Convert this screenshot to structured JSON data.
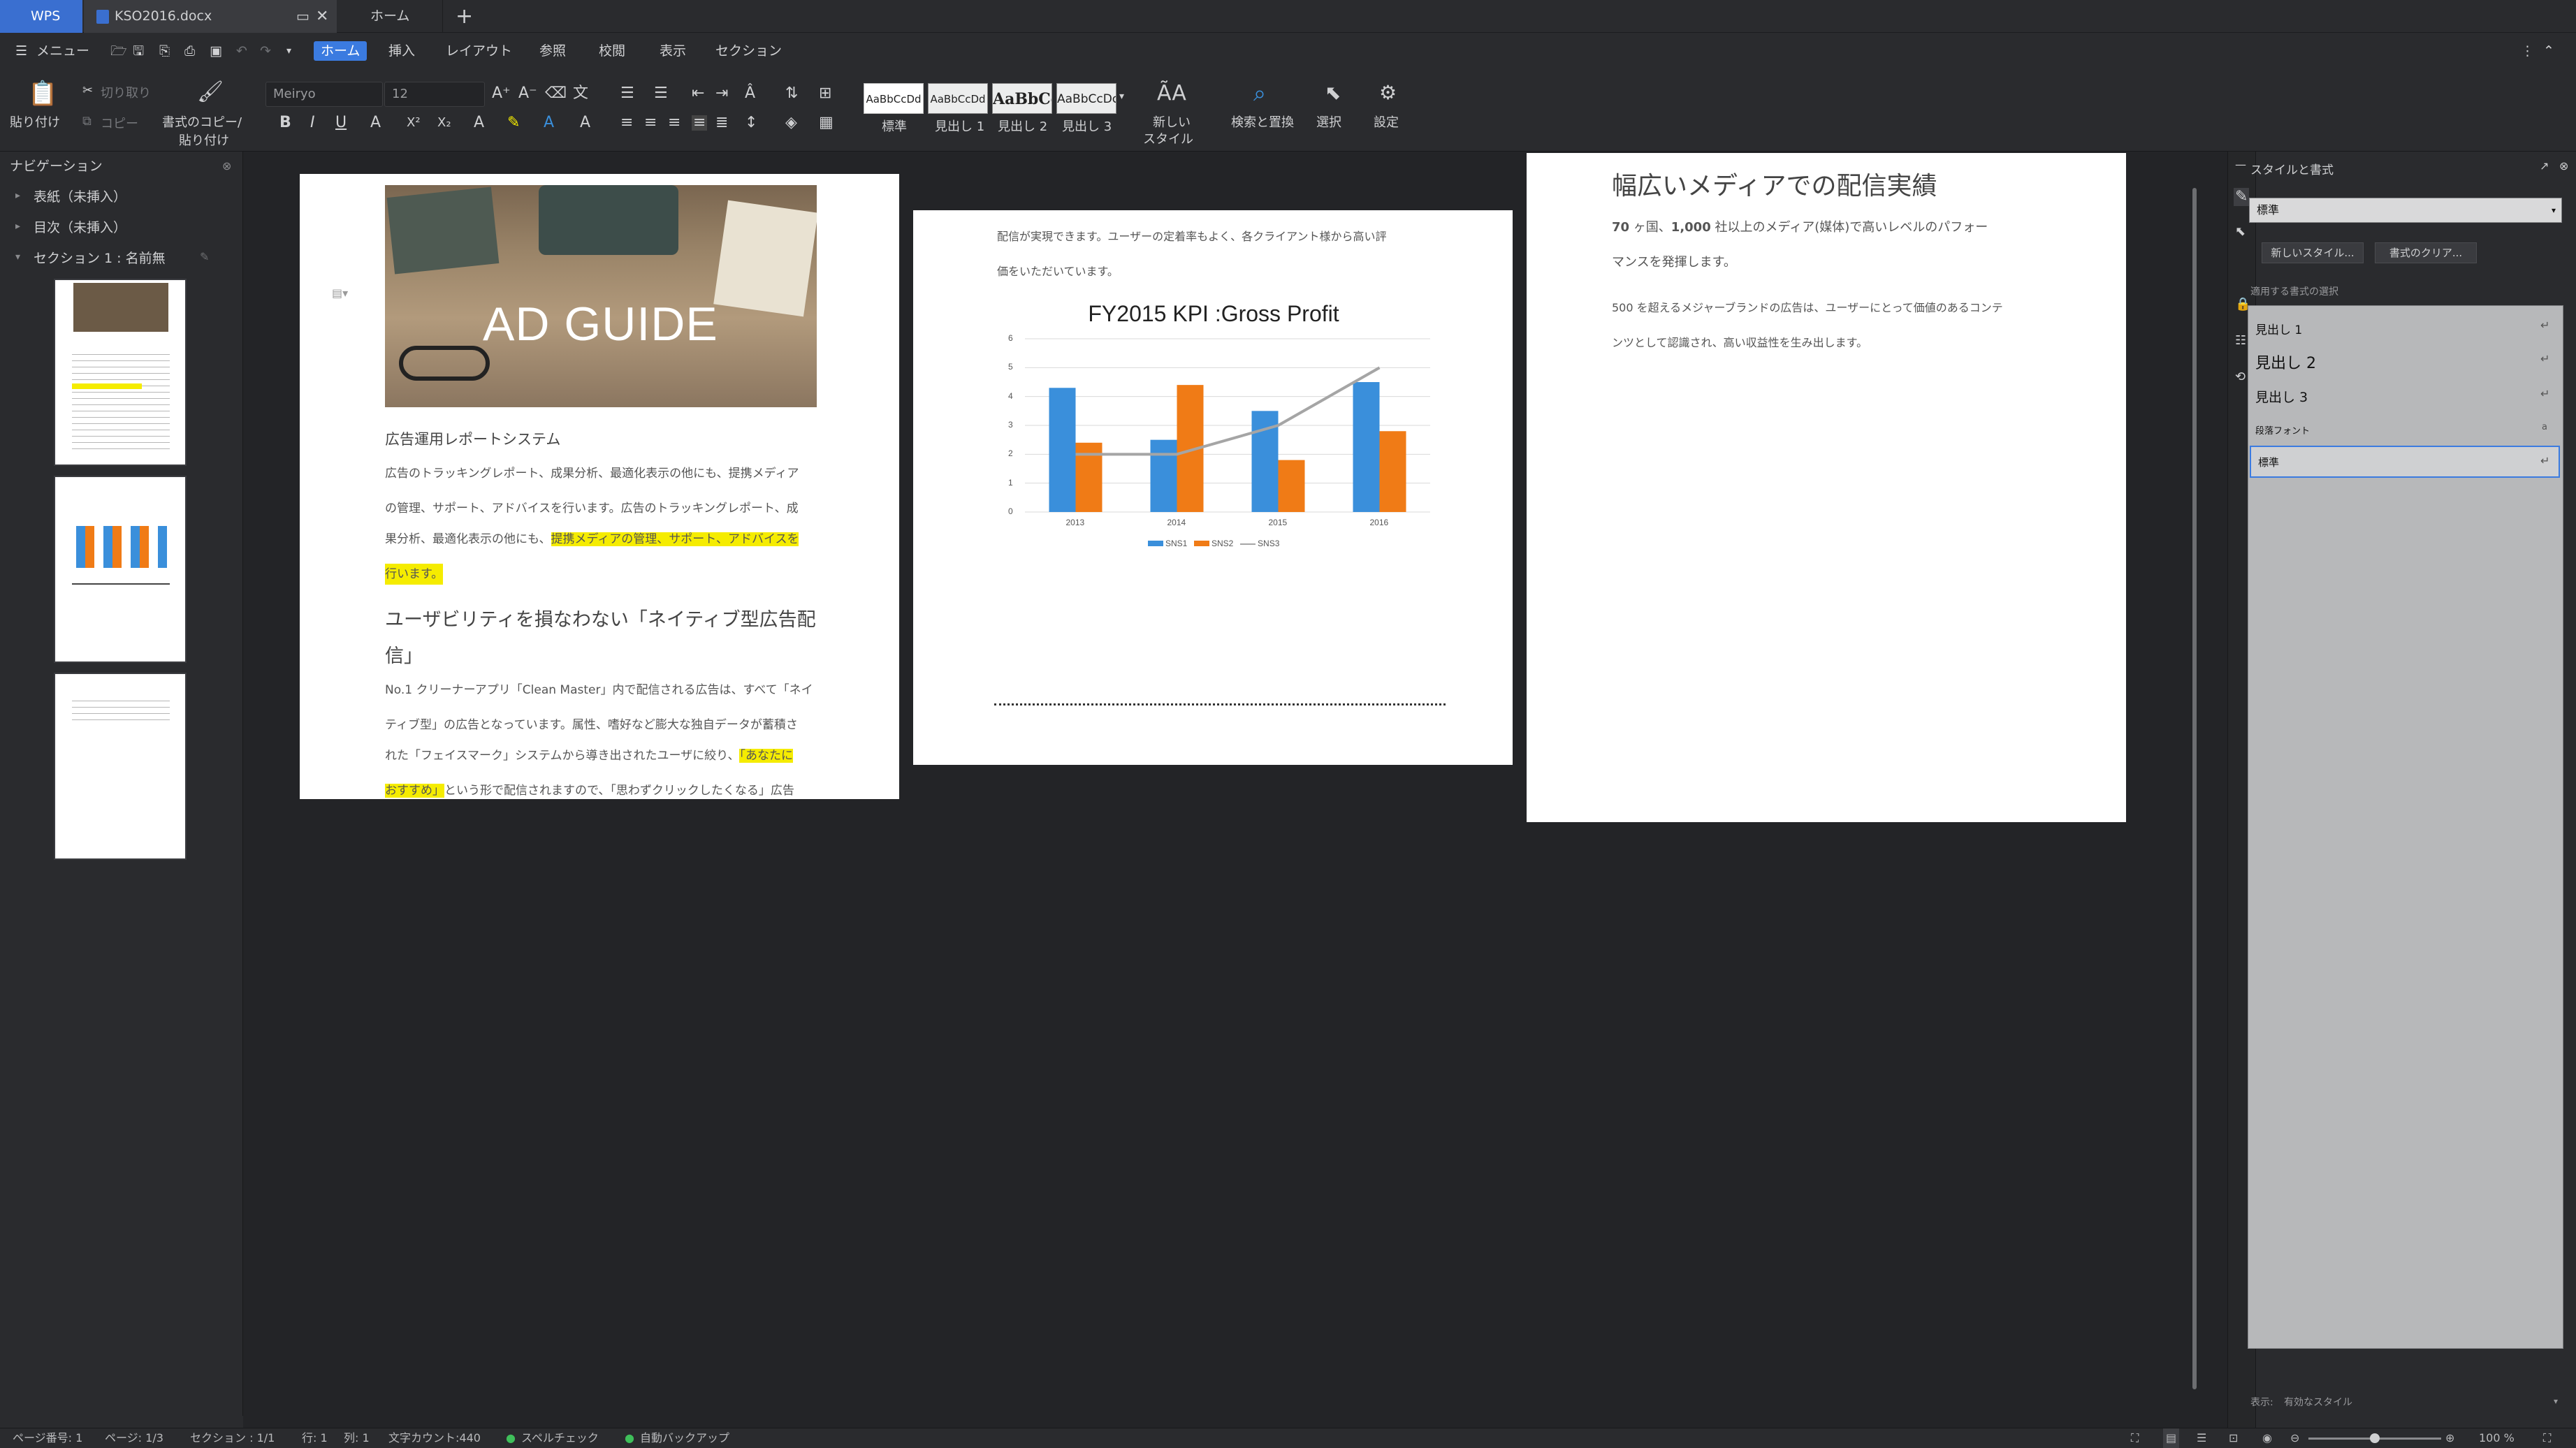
{
  "tabs": {
    "wps": "WPS",
    "doc": "KSO2016.docx",
    "home": "ホーム",
    "new": "+"
  },
  "menu": {
    "main": "メニュー",
    "items": [
      "ホーム",
      "挿入",
      "レイアウト",
      "参照",
      "校閲",
      "表示",
      "セクション"
    ]
  },
  "ribbon": {
    "paste": "貼り付け",
    "cut": "切り取り",
    "copy": "コピー",
    "format_copy": "書式のコピー/",
    "format_paste": "貼り付け",
    "font_name": "Meiryo",
    "font_size": "12",
    "styles": [
      {
        "preview": "AaBbCcDd",
        "label": "標準"
      },
      {
        "preview": "AaBbCcDd",
        "label": "見出し 1"
      },
      {
        "preview": "AaBbCc",
        "label": "見出し 2"
      },
      {
        "preview": "AaBbCcDc",
        "label": "見出し 3"
      }
    ],
    "new_style_1": "新しい",
    "new_style_2": "スタイル",
    "find_replace": "検索と置換",
    "select": "選択",
    "settings": "設定"
  },
  "nav": {
    "title": "ナビゲーション",
    "items": [
      "表紙（未挿入）",
      "目次（未挿入）",
      "セクション 1 : 名前無"
    ]
  },
  "page1": {
    "hero": "AD GUIDE",
    "heading1": "広告運用レポートシステム",
    "para1": [
      "広告のトラッキングレポート、成果分析、最適化表示の他にも、提携メディア",
      "の管理、サポート、アドバイスを行います。広告のトラッキングレポート、成",
      "果分析、最適化表示の他にも、",
      "提携メディアの管理、サポート、アドバイスを",
      "行います。"
    ],
    "heading2a": "ユーザビリティを損なわない「ネイティブ型広告配",
    "heading2b": "信」",
    "para2": [
      "No.1 クリーナーアプリ「Clean Master」内で配信される広告は、すべて「ネイ",
      "ティブ型」の広告となっています。属性、嗜好など膨大な独自データが蓄積さ",
      "れた「フェイスマーク」システムから導き出されたユーザに絞り、",
      "「あなたに",
      "おすすめ」",
      "という形で配信されますので、「思わずクリックしたくなる」広告"
    ]
  },
  "page2": {
    "text1": "配信が実現できます。ユーザーの定着率もよく、各クライアント様から高い評",
    "text2": "価をいただいています。"
  },
  "chart_data": {
    "type": "bar",
    "title": "FY2015 KPI :Gross Profit",
    "categories": [
      "2013",
      "2014",
      "2015",
      "2016"
    ],
    "series": [
      {
        "name": "SNS1",
        "type": "bar",
        "color": "#3a8fdb",
        "values": [
          4.3,
          2.5,
          3.5,
          4.5
        ]
      },
      {
        "name": "SNS2",
        "type": "bar",
        "color": "#f07b16",
        "values": [
          2.4,
          4.4,
          1.8,
          2.8
        ]
      },
      {
        "name": "SNS3",
        "type": "line",
        "color": "#a5a5a5",
        "values": [
          2,
          2,
          3,
          5
        ]
      }
    ],
    "ylim": [
      0,
      6
    ],
    "yticks": [
      "0",
      "1",
      "2",
      "3",
      "4",
      "5",
      "6"
    ],
    "grid": true,
    "legend": "bottom"
  },
  "page3": {
    "title": "幅広いメディアでの配信実績",
    "line1a": "70",
    "line1b": " ヶ国、",
    "line1c": "1,000",
    "line1d": " 社以上のメディア(媒体)で高いレベルのパフォー",
    "line2": "マンスを発揮します。",
    "line3": "500 を超えるメジャーブランドの広告は、ユーザーにとって価値のあるコンテ",
    "line4": "ンツとして認識され、高い収益性を生み出します。"
  },
  "rightpane": {
    "title": "スタイルと書式",
    "current": "標準",
    "new_style": "新しいスタイル...",
    "clear": "書式のクリア...",
    "section_label": "適用する書式の選択",
    "styles": [
      "見出し 1",
      "見出し 2",
      "見出し 3",
      "段落フォント",
      "標準"
    ],
    "show_label": "表示:",
    "show_value": "有効なスタイル"
  },
  "status": {
    "page_no": "ページ番号: 1",
    "page": "ページ: 1/3",
    "section": "セクション : 1/1",
    "row": "行: 1",
    "col": "列: 1",
    "chars": "文字カウント:440",
    "spell": "スペルチェック",
    "backup": "自動バックアップ",
    "zoom": "100 %"
  }
}
